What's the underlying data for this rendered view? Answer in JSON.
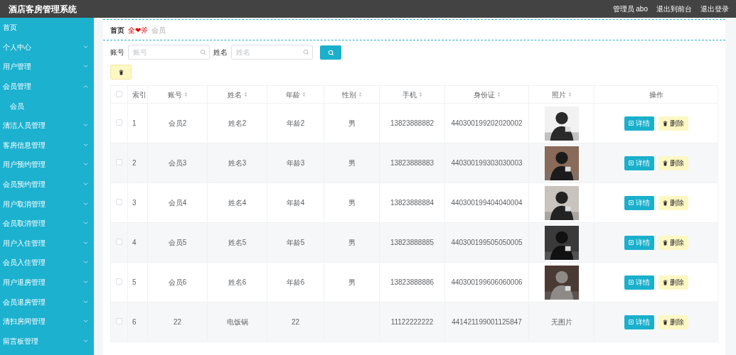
{
  "header": {
    "title": "酒店客房管理系统",
    "links": [
      {
        "label": "管理员 abo"
      },
      {
        "label": "退出到前台"
      },
      {
        "label": "退出登录"
      }
    ]
  },
  "sidebar": {
    "items": [
      {
        "label": "首页",
        "kind": "link"
      },
      {
        "label": "个人中心",
        "kind": "menu",
        "expanded": false
      },
      {
        "label": "用户管理",
        "kind": "menu",
        "expanded": false
      },
      {
        "label": "会员管理",
        "kind": "menu",
        "expanded": true,
        "children": [
          {
            "label": "会员"
          }
        ]
      },
      {
        "label": "清洁人员管理",
        "kind": "menu",
        "expanded": false
      },
      {
        "label": "客房信息管理",
        "kind": "menu",
        "expanded": false
      },
      {
        "label": "用户预约管理",
        "kind": "menu",
        "expanded": false
      },
      {
        "label": "会员预约管理",
        "kind": "menu",
        "expanded": false
      },
      {
        "label": "用户取消管理",
        "kind": "menu",
        "expanded": false
      },
      {
        "label": "会员取消管理",
        "kind": "menu",
        "expanded": false
      },
      {
        "label": "用户入住管理",
        "kind": "menu",
        "expanded": false
      },
      {
        "label": "会员入住管理",
        "kind": "menu",
        "expanded": false
      },
      {
        "label": "用户退房管理",
        "kind": "menu",
        "expanded": false
      },
      {
        "label": "会员退房管理",
        "kind": "menu",
        "expanded": false
      },
      {
        "label": "清扫房间管理",
        "kind": "menu",
        "expanded": false
      },
      {
        "label": "留言板管理",
        "kind": "menu",
        "expanded": false
      }
    ]
  },
  "breadcrumb": {
    "home": "首页",
    "ornament": "全❤斧",
    "current": "会员"
  },
  "search": {
    "fields": [
      {
        "label": "账号",
        "placeholder": "账号"
      },
      {
        "label": "姓名",
        "placeholder": "姓名"
      }
    ]
  },
  "table": {
    "all_checked": false,
    "columns": [
      {
        "label": "索引",
        "sortable": false
      },
      {
        "label": "账号",
        "sortable": true
      },
      {
        "label": "姓名",
        "sortable": true
      },
      {
        "label": "年龄",
        "sortable": true
      },
      {
        "label": "性别",
        "sortable": true
      },
      {
        "label": "手机",
        "sortable": true
      },
      {
        "label": "身份证",
        "sortable": true
      },
      {
        "label": "照片",
        "sortable": true
      },
      {
        "label": "操作",
        "sortable": false
      }
    ],
    "rows": [
      {
        "checked": false,
        "cells": [
          "1",
          "会员2",
          "姓名2",
          "年龄2",
          "男",
          "13823888882",
          "440300199202020002"
        ],
        "photo": {
          "kind": "picture"
        },
        "actions": [
          "详情",
          "删除"
        ]
      },
      {
        "checked": false,
        "cells": [
          "2",
          "会员3",
          "姓名3",
          "年龄3",
          "男",
          "13823888883",
          "440300199303030003"
        ],
        "photo": {
          "kind": "picture"
        },
        "actions": [
          "详情",
          "删除"
        ]
      },
      {
        "checked": false,
        "cells": [
          "3",
          "会员4",
          "姓名4",
          "年龄4",
          "男",
          "13823888884",
          "440300199404040004"
        ],
        "photo": {
          "kind": "picture"
        },
        "actions": [
          "详情",
          "删除"
        ]
      },
      {
        "checked": false,
        "cells": [
          "4",
          "会员5",
          "姓名5",
          "年龄5",
          "男",
          "13823888885",
          "440300199505050005"
        ],
        "photo": {
          "kind": "picture"
        },
        "actions": [
          "详情",
          "删除"
        ]
      },
      {
        "checked": false,
        "cells": [
          "5",
          "会员6",
          "姓名6",
          "年龄6",
          "男",
          "13823888886",
          "440300199606060006"
        ],
        "photo": {
          "kind": "picture"
        },
        "actions": [
          "详情",
          "删除"
        ]
      },
      {
        "checked": false,
        "cells": [
          "6",
          "22",
          "电饭锅",
          "22",
          "",
          "11122222222",
          "441421199001125847"
        ],
        "photo": {
          "kind": "text",
          "text": "无图片"
        },
        "actions": [
          "详情",
          "删除"
        ]
      }
    ]
  }
}
